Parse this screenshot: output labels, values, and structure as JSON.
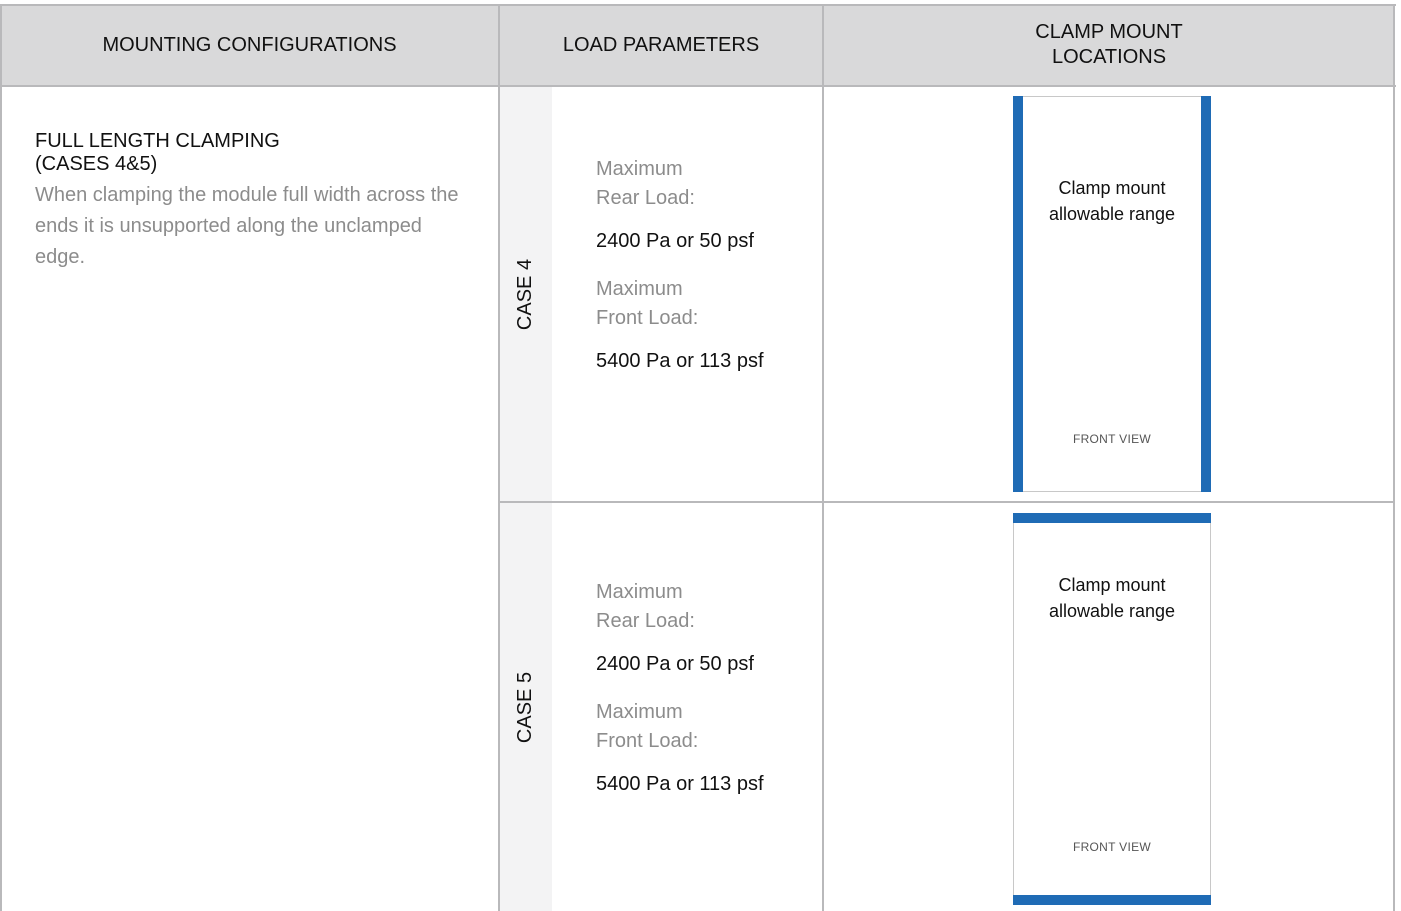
{
  "table": {
    "headers": [
      "MOUNTING CONFIGURATIONS",
      "LOAD PARAMETERS",
      "CLAMP MOUNT LOCATIONS"
    ],
    "configuration": {
      "title_line1": "FULL LENGTH CLAMPING",
      "title_line2": "(CASES 4&5)",
      "description": "When clamping the module full width across the ends it is unsupported along the unclamped edge."
    },
    "cases": [
      {
        "label": "CASE 4",
        "rear_label_line1": "Maximum",
        "rear_label_line2": "Rear Load:",
        "rear_value": "2400 Pa or 50 psf",
        "front_label_line1": "Maximum",
        "front_label_line2": "Front Load:",
        "front_value": "5400 Pa or 113 psf",
        "diagram_line1": "Clamp mount",
        "diagram_line2": "allowable range",
        "diagram_view": "FRONT VIEW",
        "clamp_edges": "long sides"
      },
      {
        "label": "CASE 5",
        "rear_label_line1": "Maximum",
        "rear_label_line2": "Rear Load:",
        "rear_value": "2400 Pa or 50 psf",
        "front_label_line1": "Maximum",
        "front_label_line2": "Front Load:",
        "front_value": "5400 Pa or 113 psf",
        "diagram_line1": "Clamp mount",
        "diagram_line2": "allowable range",
        "diagram_view": "FRONT VIEW",
        "clamp_edges": "short ends"
      }
    ],
    "colors": {
      "header_bg": "#d9d9da",
      "grid_line": "#b9b9bb",
      "case_strip_bg": "#f3f3f4",
      "clamp_rail": "#1f6bb5",
      "muted_text": "#8c8c8c"
    }
  }
}
